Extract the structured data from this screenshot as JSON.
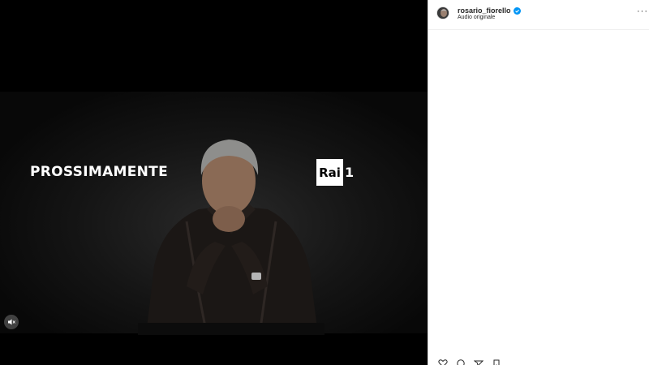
{
  "media": {
    "overlay_text": "PROSSIMAMENTE",
    "channel_box": "Rai",
    "channel_number": "1"
  },
  "post": {
    "username": "rosario_fiorello",
    "verified": true,
    "audio_label": "Audio originale",
    "more_label": "···"
  },
  "colors": {
    "verified_badge": "#0095f6",
    "panel_bg": "#ffffff",
    "media_bg": "#000000"
  },
  "icons": [
    "volume-muted-icon",
    "verified-badge-icon",
    "more-options-icon",
    "like-icon",
    "comment-icon",
    "share-icon",
    "save-icon"
  ]
}
